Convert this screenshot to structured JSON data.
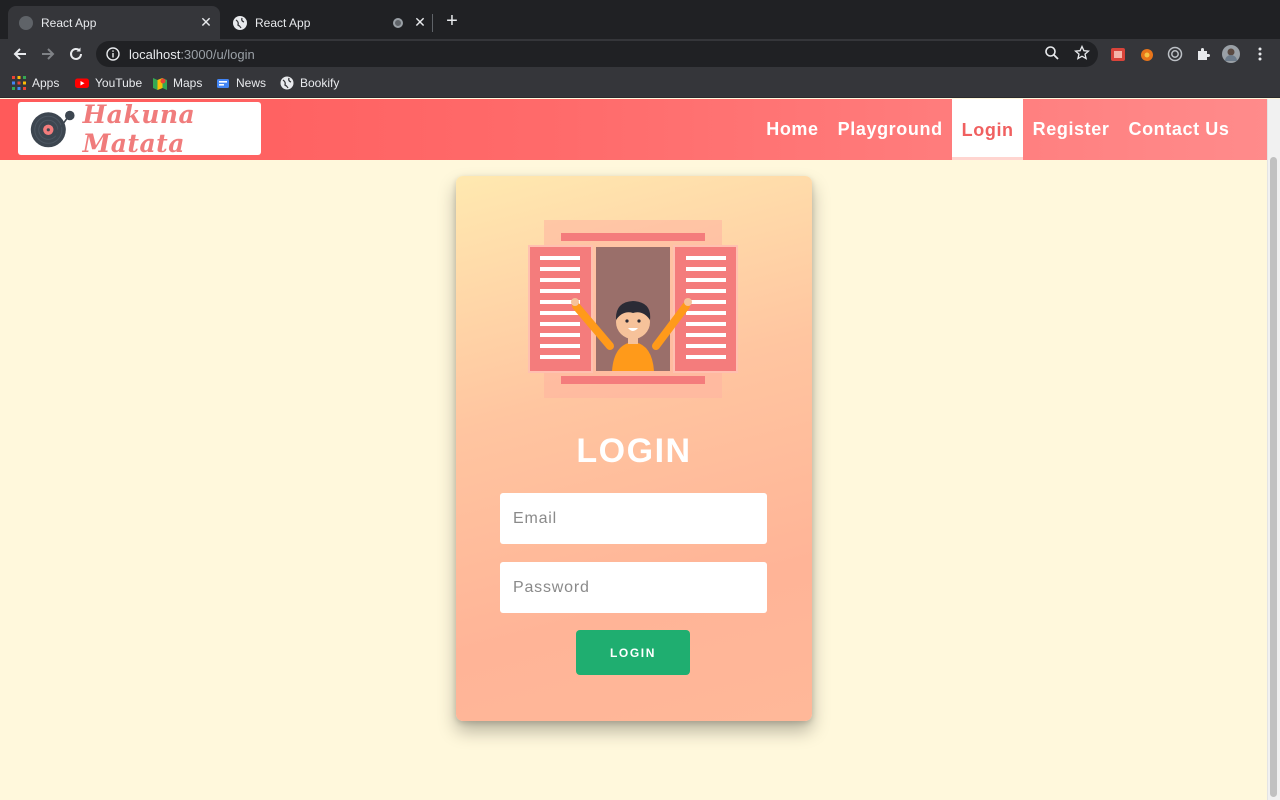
{
  "browser": {
    "tabs": [
      {
        "title": "React App",
        "active": true
      },
      {
        "title": "React App",
        "active": false
      }
    ],
    "address": {
      "host": "localhost",
      "path": ":3000/u/login"
    },
    "bookmarks": [
      {
        "label": "Apps",
        "icon": "apps-grid-icon"
      },
      {
        "label": "YouTube",
        "icon": "youtube-icon"
      },
      {
        "label": "Maps",
        "icon": "maps-icon"
      },
      {
        "label": "News",
        "icon": "news-icon"
      },
      {
        "label": "Bookify",
        "icon": "globe-icon"
      }
    ]
  },
  "site": {
    "logo_text": "Hakuna Matata",
    "nav": [
      {
        "label": "Home",
        "active": false
      },
      {
        "label": "Playground",
        "active": false
      },
      {
        "label": "Login",
        "active": true
      },
      {
        "label": "Register",
        "active": false
      },
      {
        "label": "Contact Us",
        "active": false
      }
    ]
  },
  "login": {
    "title": "LOGIN",
    "email_placeholder": "Email",
    "password_placeholder": "Password",
    "button_label": "LOGIN"
  },
  "colors": {
    "navbar_accent": "#ff5a5a",
    "active_nav_text": "#f06060",
    "page_background": "#fff8dc",
    "button_green": "#1fae70"
  }
}
